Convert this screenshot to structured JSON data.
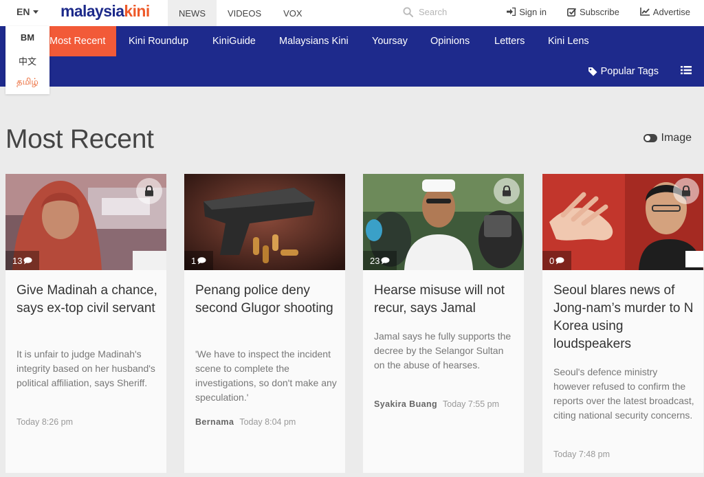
{
  "topbar": {
    "language": "EN",
    "logo_part1": "malaysia",
    "logo_part2": "kini",
    "sections": [
      "NEWS",
      "VIDEOS",
      "VOX"
    ],
    "search_placeholder": "Search",
    "sign_in": "Sign in",
    "subscribe": "Subscribe",
    "advertise": "Advertise"
  },
  "lang_menu": [
    "BM",
    "中文",
    "தமிழ்"
  ],
  "nav": {
    "items": [
      "Most Recent",
      "Kini Roundup",
      "KiniGuide",
      "Malaysians Kini",
      "Yoursay",
      "Opinions",
      "Letters",
      "Kini Lens"
    ],
    "popular_tags": "Popular Tags"
  },
  "page": {
    "title": "Most Recent",
    "image_toggle": "Image"
  },
  "articles": [
    {
      "comments": "13",
      "title": "Give Madinah a chance, says ex-top civil servant",
      "desc": "It is unfair to judge Madinah's integrity based on her husband's political affiliation, says Sheriff.",
      "author": "",
      "time": "Today 8:26 pm"
    },
    {
      "comments": "1",
      "title": "Penang police deny second Glugor shooting",
      "desc": "'We have to inspect the incident scene to complete the investigations, so don't make any speculation.'",
      "author": "Bernama",
      "time": "Today 8:04 pm"
    },
    {
      "comments": "23",
      "title": "Hearse misuse will not recur, says Jamal",
      "desc": "Jamal says he fully supports the decree by the Selangor Sultan on the abuse of hearses.",
      "author": "Syakira Buang",
      "time": "Today 7:55 pm"
    },
    {
      "comments": "0",
      "title": "Seoul blares news of Jong-nam’s murder to N Korea using loudspeakers",
      "desc": "Seoul's defence ministry however refused to confirm the reports over the latest broadcast, citing national security concerns.",
      "author": "",
      "time": "Today 7:48 pm"
    }
  ]
}
